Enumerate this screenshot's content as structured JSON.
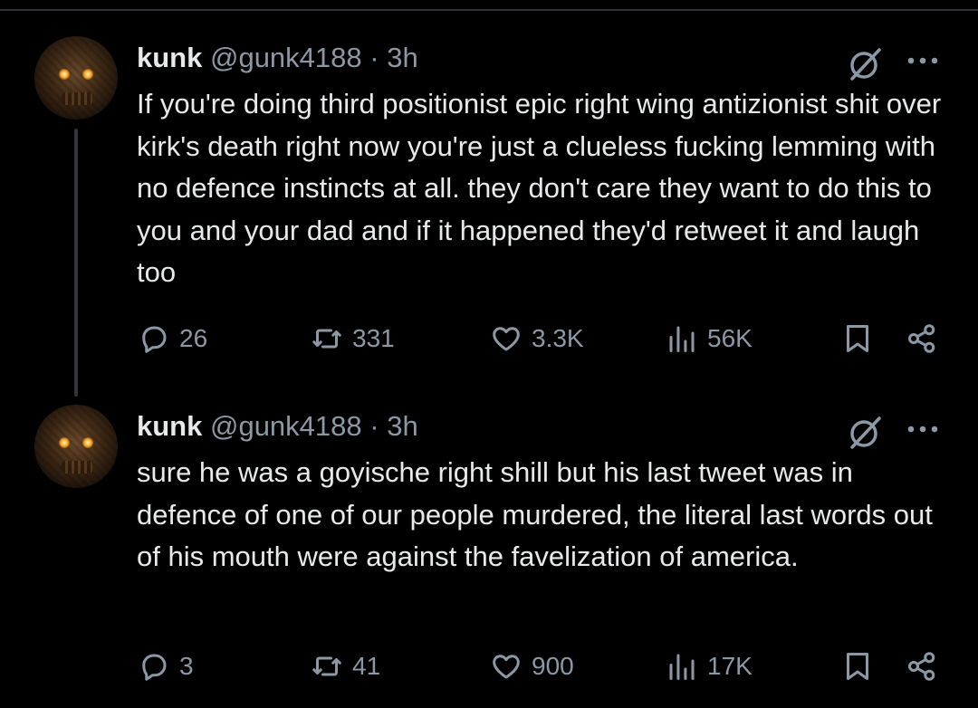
{
  "tweets": [
    {
      "name": "kunk",
      "handle": "@gunk4188",
      "separator": "·",
      "time": "3h",
      "text": "If you're doing third positionist epic right wing antizionist shit over kirk's death right now you're just a clueless fucking lemming with no defence instincts at all. they don't care they want to do this to you and your dad and if it happened they'd retweet it and laugh too",
      "stats": {
        "replies": "26",
        "reposts": "331",
        "likes": "3.3K",
        "views": "56K"
      }
    },
    {
      "name": "kunk",
      "handle": "@gunk4188",
      "separator": "·",
      "time": "3h",
      "text": "sure he was a goyische right shill but his last tweet was in defence of one of our people murdered, the literal last words out of his mouth were against the favelization of america.",
      "stats": {
        "replies": "3",
        "reposts": "41",
        "likes": "900",
        "views": "17K"
      }
    }
  ],
  "icons": [
    "grok-icon",
    "more-icon",
    "reply-icon",
    "repost-icon",
    "like-icon",
    "views-icon",
    "bookmark-icon",
    "share-icon"
  ],
  "colors": {
    "background": "#000000",
    "text": "#e7e9ea",
    "secondary": "#8b98a5",
    "thread_line": "#333639"
  }
}
